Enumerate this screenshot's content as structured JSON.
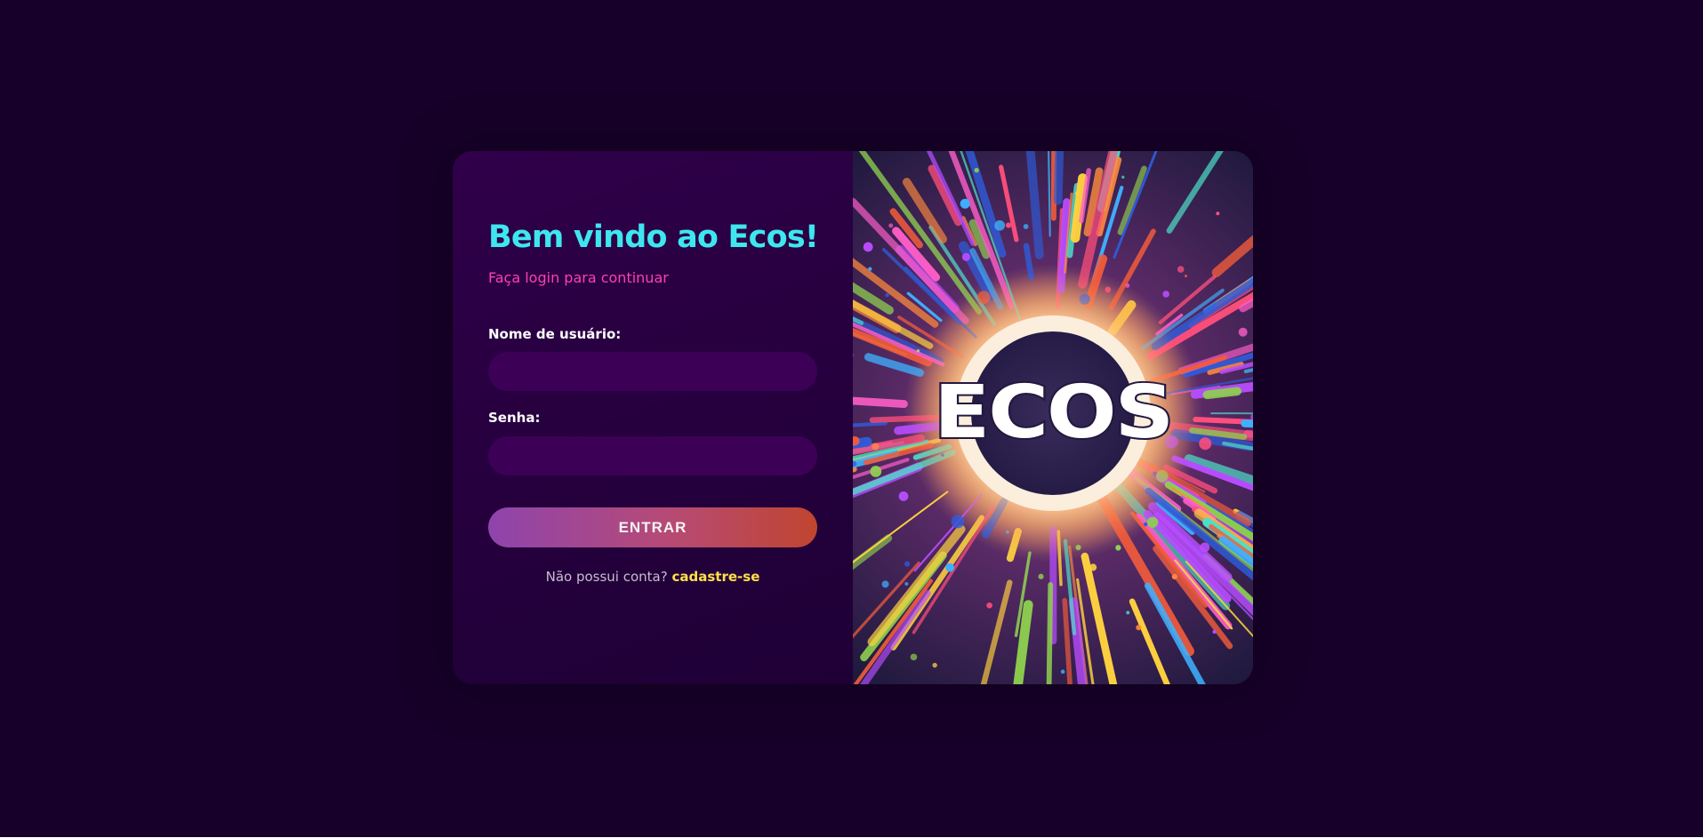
{
  "login": {
    "title": "Bem vindo ao Ecos!",
    "subtitle": "Faça login para continuar",
    "username_label": "Nome de usuário:",
    "username_value": "",
    "password_label": "Senha:",
    "password_value": "",
    "submit_label": "ENTRAR",
    "signup_prompt": "Não possui conta?",
    "signup_link": "cadastre-se"
  },
  "art": {
    "logo_text": "ECOS"
  },
  "colors": {
    "page_background": "#170029",
    "panel_background": "#2b0044",
    "input_background": "#3d0057",
    "title": "#3ee6f0",
    "subtitle": "#ff3fb4",
    "link": "#ffe04a",
    "button_gradient_start": "#8e44ad",
    "button_gradient_end": "#c0452f"
  }
}
